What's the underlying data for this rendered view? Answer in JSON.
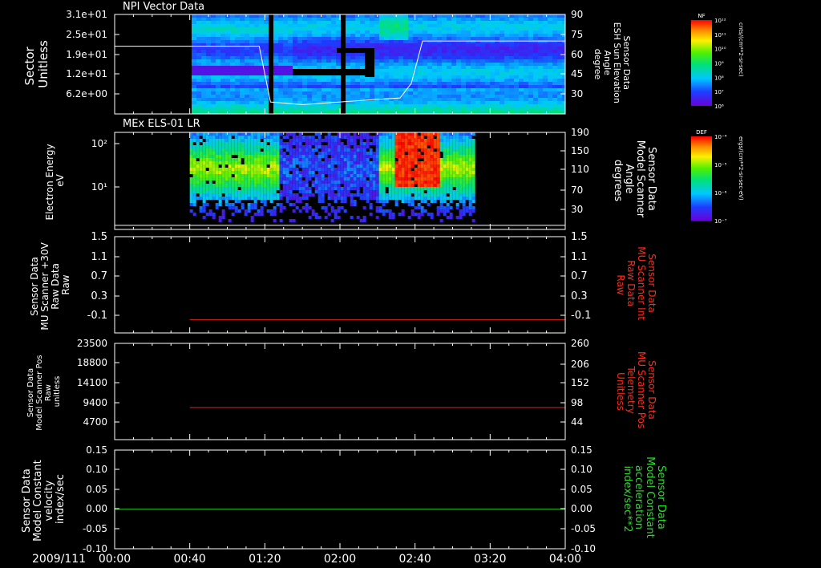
{
  "figure": {
    "date_label": "2009/111",
    "time_ticks": [
      "00:00",
      "00:40",
      "01:20",
      "02:00",
      "02:40",
      "03:20",
      "04:00"
    ]
  },
  "chart_data": [
    {
      "id": "panel-npi",
      "type": "heatmap",
      "title": "NPI Vector Data",
      "ylabel": [
        "Sector",
        "Unitless"
      ],
      "y_ticks": [
        "3.1e+01",
        "2.5e+01",
        "1.9e+01",
        "1.2e+01",
        "6.2e+00"
      ],
      "right_ylabel": [
        "Sensor Data",
        "ESH Sun Elevation",
        "Angle",
        "degree"
      ],
      "right_ylim": [
        15,
        90
      ],
      "right_ticks": [
        "90",
        "75",
        "60",
        "45",
        "30"
      ],
      "overlay_line_degrees": {
        "x": [
          "00:00",
          "01:17",
          "01:23",
          "01:40",
          "02:20",
          "02:32",
          "02:38",
          "02:44",
          "04:00"
        ],
        "y": [
          66,
          66,
          24,
          22,
          26,
          27,
          38,
          70,
          70
        ]
      },
      "data_gaps": [
        [
          "00:00",
          "00:40"
        ],
        [
          "01:20",
          "01:23"
        ],
        [
          "01:59",
          "02:02"
        ],
        [
          "02:34",
          "02:36"
        ]
      ],
      "colorbar": {
        "label": "NF",
        "unit": "cnts/(cm**2-sr-sec)",
        "ticks": [
          "10¹²",
          "10¹¹",
          "10¹⁰",
          "10⁹",
          "10⁸",
          "10⁷",
          "10⁶"
        ]
      }
    },
    {
      "id": "panel-els",
      "type": "heatmap",
      "title": "MEx ELS-01 LR",
      "ylabel": [
        "Electron Energy",
        "eV"
      ],
      "y_ticks": [
        "10²",
        "10¹"
      ],
      "right_ylabel": [
        "Sensor Data",
        "Model Scanner",
        "Angle",
        "degrees"
      ],
      "right_ylim": [
        0,
        190
      ],
      "right_ticks": [
        "190",
        "150",
        "110",
        "70",
        "30"
      ],
      "overlay_line_degrees": {
        "x": [
          "00:00",
          "04:00"
        ],
        "y": [
          8,
          8
        ]
      },
      "data_span": [
        "00:40",
        "03:12"
      ],
      "colorbar": {
        "label": "DEF",
        "unit": "ergs/(cm**2-sr-sec-eV)",
        "ticks": [
          "10⁻⁴",
          "10⁻⁵",
          "10⁻⁶",
          "10⁻⁷"
        ]
      }
    },
    {
      "id": "panel-mu-int",
      "type": "line",
      "ylabel": [
        "Sensor Data",
        "MU Scanner +30V",
        "Raw Data",
        "Raw"
      ],
      "y_ticks": [
        "1.5",
        "1.1",
        "0.7",
        "0.3",
        "-0.1"
      ],
      "ylim": [
        -0.3,
        1.5
      ],
      "right_ylabel": [
        "Sensor Data",
        "MU Scanner Int",
        "Raw Data",
        "Raw"
      ],
      "right_ticks": [
        "1.5",
        "1.1",
        "0.7",
        "0.3",
        "-0.1"
      ],
      "series": [
        {
          "x": [
            "00:40",
            "04:00"
          ],
          "y": [
            -0.05,
            -0.05
          ],
          "color": "#e0201b"
        }
      ]
    },
    {
      "id": "panel-mu-pos",
      "type": "line",
      "ylabel": [
        "Sensor Data",
        "Model Scanner Pos",
        "Raw",
        "unitless"
      ],
      "y_ticks": [
        "23500",
        "18800",
        "14100",
        "9400",
        "4700"
      ],
      "ylim": [
        0,
        23500
      ],
      "right_ylabel": [
        "Sensor Data",
        "MU Scanner Pos",
        "Telemetry",
        "Unitless"
      ],
      "right_ticks": [
        "260",
        "206",
        "152",
        "98",
        "44"
      ],
      "series": [
        {
          "x": [
            "00:40",
            "04:00"
          ],
          "y": [
            7850,
            7850
          ],
          "color": "#e0201b"
        }
      ]
    },
    {
      "id": "panel-model",
      "type": "line",
      "ylabel": [
        "Sensor Data",
        "Model Constant",
        "velocity",
        "index/sec"
      ],
      "y_ticks": [
        "0.15",
        "0.10",
        "0.05",
        "0.00",
        "-0.05",
        "-0.10"
      ],
      "ylim": [
        -0.1,
        0.15
      ],
      "right_ylabel": [
        "Sensor Data",
        "Model Constant",
        "acceleration",
        "index/sec**2"
      ],
      "right_ticks": [
        "0.15",
        "0.10",
        "0.05",
        "0.00",
        "-0.05",
        "-0.10"
      ],
      "series": [
        {
          "x": [
            "00:00",
            "04:00"
          ],
          "y": [
            0.0,
            0.0
          ],
          "color": "#1fd21f"
        }
      ]
    }
  ],
  "colors": {
    "red_label": "#ff2a1a",
    "green_label": "#22e022",
    "white": "#ffffff"
  }
}
